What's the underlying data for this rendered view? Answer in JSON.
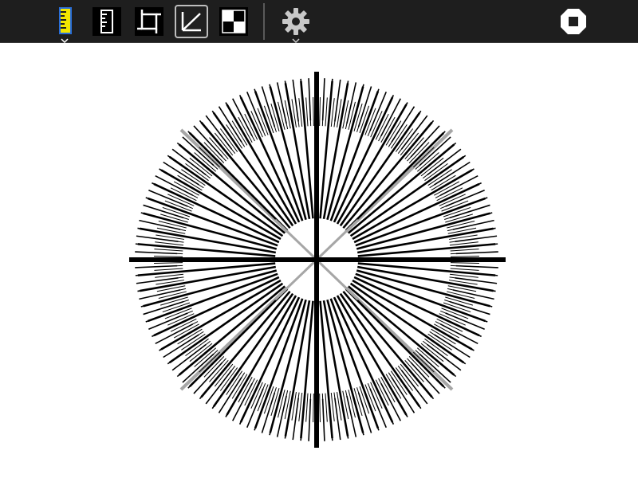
{
  "toolbar": {
    "tools": [
      {
        "name": "ruler-tool",
        "icon": "ruler-icon",
        "color": "#f2e600",
        "selected": true,
        "has_dropdown": true
      },
      {
        "name": "vertical-ruler-tool",
        "icon": "ruler-vertical-icon",
        "selected": false
      },
      {
        "name": "crop-tool",
        "icon": "crop-icon",
        "selected": false
      },
      {
        "name": "angle-tool",
        "icon": "angle-icon",
        "selected": true
      },
      {
        "name": "checker-tool",
        "icon": "checkerboard-icon",
        "selected": false
      },
      {
        "name": "settings-tool",
        "icon": "gear-icon",
        "has_dropdown": true
      }
    ],
    "stop_button": {
      "icon": "stop-icon"
    }
  },
  "pattern": {
    "type": "siemens-star-resolution-target",
    "colors": {
      "line": "#000000",
      "diagonal": "#a6a6a6",
      "background": "#ffffff",
      "toolbar": "#1e1e1e"
    },
    "spoke_groups": [
      {
        "count": 72,
        "from_radius": 52,
        "to_radius": 225,
        "thickness": 2.6
      },
      {
        "count": 144,
        "from_radius": 175,
        "to_radius": 228,
        "thickness": 1.6
      },
      {
        "count": 288,
        "from_radius": 168,
        "to_radius": 204,
        "thickness": 1.0
      }
    ],
    "axis_count": 2,
    "diagonal_count": 2
  }
}
